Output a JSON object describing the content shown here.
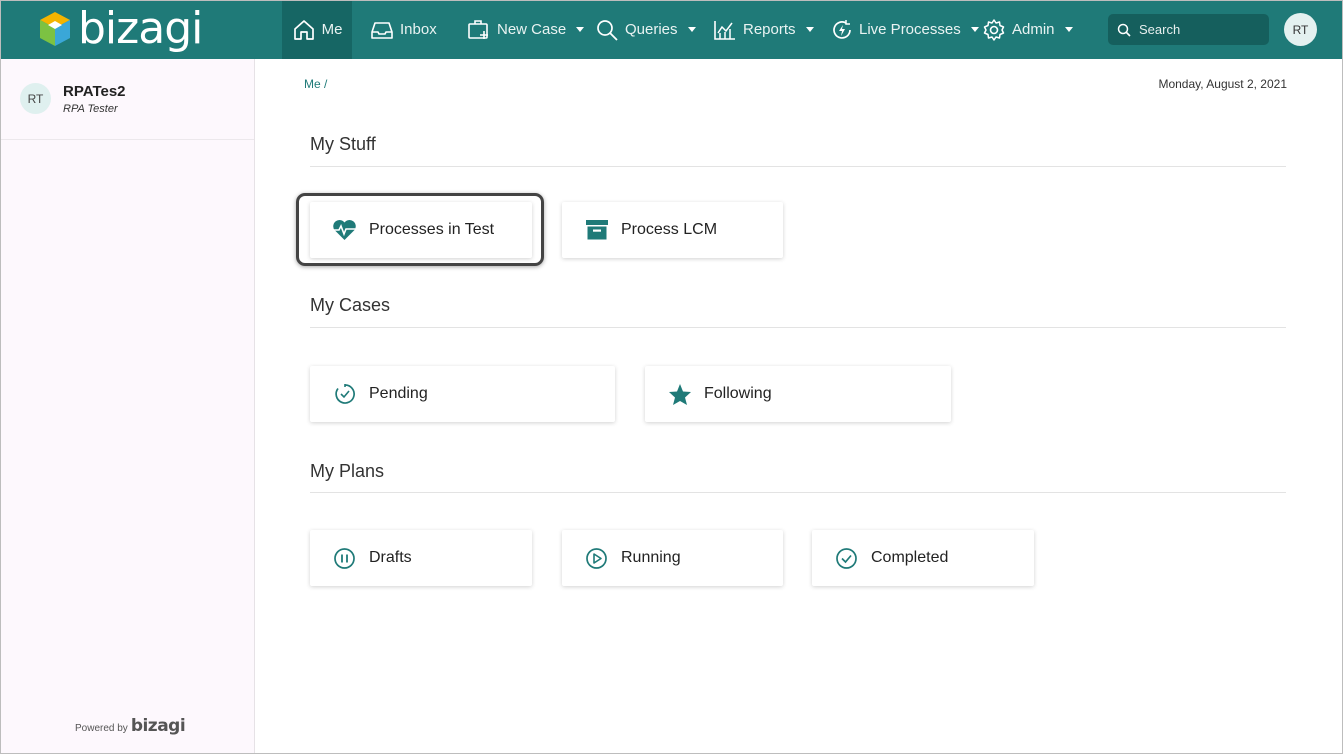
{
  "app": {
    "logo_text": "bizagi"
  },
  "nav": [
    {
      "label": "Me",
      "icon": "home-icon",
      "active": true
    },
    {
      "label": "Inbox",
      "icon": "inbox-icon"
    },
    {
      "label": "New Case",
      "icon": "new-case-icon",
      "dropdown": true
    },
    {
      "label": "Queries",
      "icon": "search-icon",
      "dropdown": true
    },
    {
      "label": "Reports",
      "icon": "reports-icon",
      "dropdown": true
    },
    {
      "label": "Live Processes",
      "icon": "live-processes-icon",
      "dropdown": true
    },
    {
      "label": "Admin",
      "icon": "gear-icon",
      "dropdown": true
    }
  ],
  "search": {
    "placeholder": "Search"
  },
  "user": {
    "initials": "RT",
    "name": "RPATes2",
    "role": "RPA Tester"
  },
  "footer": {
    "powered_label": "Powered by",
    "brand": "bizagi"
  },
  "breadcrumb": "Me /",
  "date": "Monday, August 2, 2021",
  "sections": {
    "my_stuff": {
      "title": "My Stuff",
      "cards": [
        {
          "label": "Processes in Test",
          "icon": "heartbeat-icon",
          "highlighted": true
        },
        {
          "label": "Process LCM",
          "icon": "archive-box-icon"
        }
      ]
    },
    "my_cases": {
      "title": "My Cases",
      "cards": [
        {
          "label": "Pending",
          "icon": "timer-icon"
        },
        {
          "label": "Following",
          "icon": "star-icon"
        }
      ]
    },
    "my_plans": {
      "title": "My Plans",
      "cards": [
        {
          "label": "Drafts",
          "icon": "pause-circle-icon"
        },
        {
          "label": "Running",
          "icon": "play-circle-icon"
        },
        {
          "label": "Completed",
          "icon": "check-circle-icon"
        }
      ]
    }
  },
  "colors": {
    "brand": "#1f7a78",
    "brand_dark": "#166664",
    "sidebar_bg": "#fdf8fd",
    "icon": "#1f7a78"
  }
}
